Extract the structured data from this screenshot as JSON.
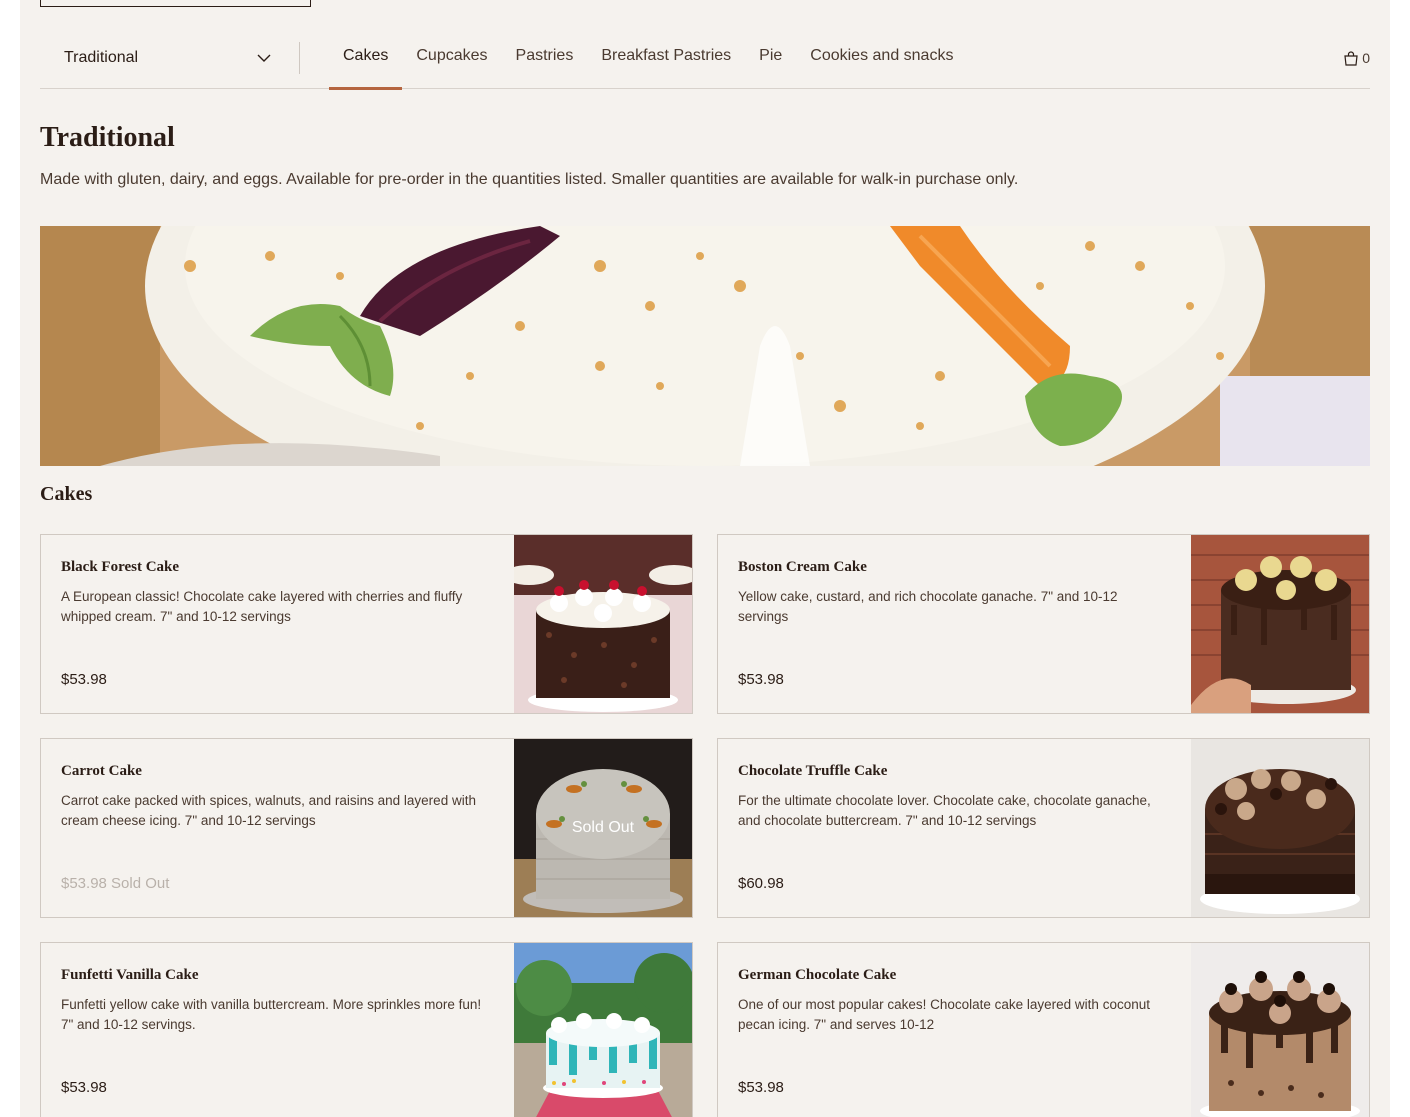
{
  "menu": {
    "selected_menu": "Traditional",
    "tabs": [
      {
        "label": "Cakes",
        "active": true
      },
      {
        "label": "Cupcakes"
      },
      {
        "label": "Pastries"
      },
      {
        "label": "Breakfast Pastries"
      },
      {
        "label": "Pie"
      },
      {
        "label": "Cookies and snacks"
      }
    ],
    "cart_count": "0"
  },
  "section": {
    "title": "Traditional",
    "description": "Made with gluten, dairy, and eggs. Available for pre-order in the quantities listed. Smaller quantities are available for walk-in purchase only."
  },
  "group": {
    "title": "Cakes"
  },
  "items": [
    {
      "name": "Black Forest Cake",
      "description": "A European classic! Chocolate cake layered with cherries and fluffy whipped cream. 7\" and 10-12 servings",
      "price": "$53.98"
    },
    {
      "name": "Boston Cream Cake",
      "description": "Yellow cake, custard, and rich chocolate ganache. 7\" and 10-12 servings",
      "price": "$53.98"
    },
    {
      "name": "Carrot Cake",
      "description": "Carrot cake packed with spices, walnuts, and raisins and layered with cream cheese icing. 7\" and 10-12 servings",
      "price": "$53.98 Sold Out",
      "image_overlay": "Sold Out"
    },
    {
      "name": "Chocolate Truffle Cake",
      "description": "For the ultimate chocolate lover. Chocolate cake, chocolate ganache, and chocolate buttercream. 7\" and 10-12 servings",
      "price": "$60.98"
    },
    {
      "name": "Funfetti Vanilla Cake",
      "description": "Funfetti yellow cake with vanilla buttercream. More sprinkles more fun! 7\" and 10-12 servings.",
      "price": "$53.98"
    },
    {
      "name": "German Chocolate Cake",
      "description": "One of our most popular cakes! Chocolate cake layered with coconut pecan icing. 7\" and serves 10-12",
      "price": "$53.98"
    }
  ],
  "colors": {
    "background": "#f5f2ee",
    "accent": "#b5653f",
    "text": "#2b1d16"
  },
  "icons": {
    "dropdown": "chevron-down-icon",
    "cart": "shopping-bag-icon"
  }
}
